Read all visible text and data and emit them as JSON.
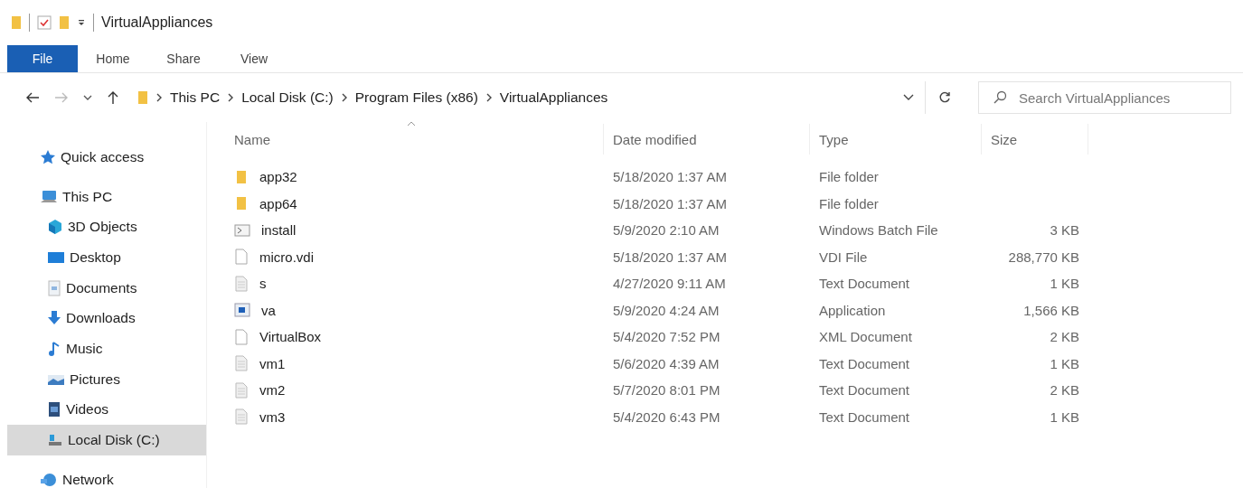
{
  "window": {
    "title": "VirtualAppliances"
  },
  "ribbon_tabs": [
    {
      "label": "File",
      "selected": true
    },
    {
      "label": "Home",
      "selected": false
    },
    {
      "label": "Share",
      "selected": false
    },
    {
      "label": "View",
      "selected": false
    }
  ],
  "address_bar": {
    "path": [
      "This PC",
      "Local Disk (C:)",
      "Program Files (x86)",
      "VirtualAppliances"
    ]
  },
  "search": {
    "placeholder": "Search VirtualAppliances"
  },
  "sidebar": {
    "items": [
      {
        "label": "Quick access",
        "selected": false
      },
      {
        "label": "This PC",
        "selected": false,
        "children": [
          {
            "label": "3D Objects",
            "selected": false
          },
          {
            "label": "Desktop",
            "selected": false
          },
          {
            "label": "Documents",
            "selected": false
          },
          {
            "label": "Downloads",
            "selected": false
          },
          {
            "label": "Music",
            "selected": false
          },
          {
            "label": "Pictures",
            "selected": false
          },
          {
            "label": "Videos",
            "selected": false
          },
          {
            "label": "Local Disk (C:)",
            "selected": true
          }
        ]
      },
      {
        "label": "Network",
        "selected": false
      }
    ]
  },
  "table": {
    "columns": [
      "Name",
      "Date modified",
      "Type",
      "Size"
    ],
    "rows": [
      {
        "kind": "folder",
        "name": "app32",
        "date": "5/18/2020 1:37 AM",
        "type": "File folder"
      },
      {
        "kind": "folder",
        "name": "app64",
        "date": "5/18/2020 1:37 AM",
        "type": "File folder"
      },
      {
        "kind": "batch",
        "name": "install",
        "date": "5/9/2020 2:10 AM",
        "type": "Windows Batch File",
        "size": "3 KB"
      },
      {
        "kind": "blank",
        "name": "micro.vdi",
        "date": "5/18/2020 1:37 AM",
        "type": "VDI File",
        "size": "288,770 KB"
      },
      {
        "kind": "text",
        "name": "s",
        "date": "4/27/2020 9:11 AM",
        "type": "Text Document",
        "size": "1 KB"
      },
      {
        "kind": "app",
        "name": "va",
        "date": "5/9/2020 4:24 AM",
        "type": "Application",
        "size": "1,566 KB"
      },
      {
        "kind": "blank",
        "name": "VirtualBox",
        "date": "5/4/2020 7:52 PM",
        "type": "XML Document",
        "size": "2 KB"
      },
      {
        "kind": "text",
        "name": "vm1",
        "date": "5/6/2020 4:39 AM",
        "type": "Text Document",
        "size": "1 KB"
      },
      {
        "kind": "text",
        "name": "vm2",
        "date": "5/7/2020 8:01 PM",
        "type": "Text Document",
        "size": "2 KB"
      },
      {
        "kind": "text",
        "name": "vm3",
        "date": "5/4/2020 6:43 PM",
        "type": "Text Document",
        "size": "1 KB"
      }
    ]
  }
}
